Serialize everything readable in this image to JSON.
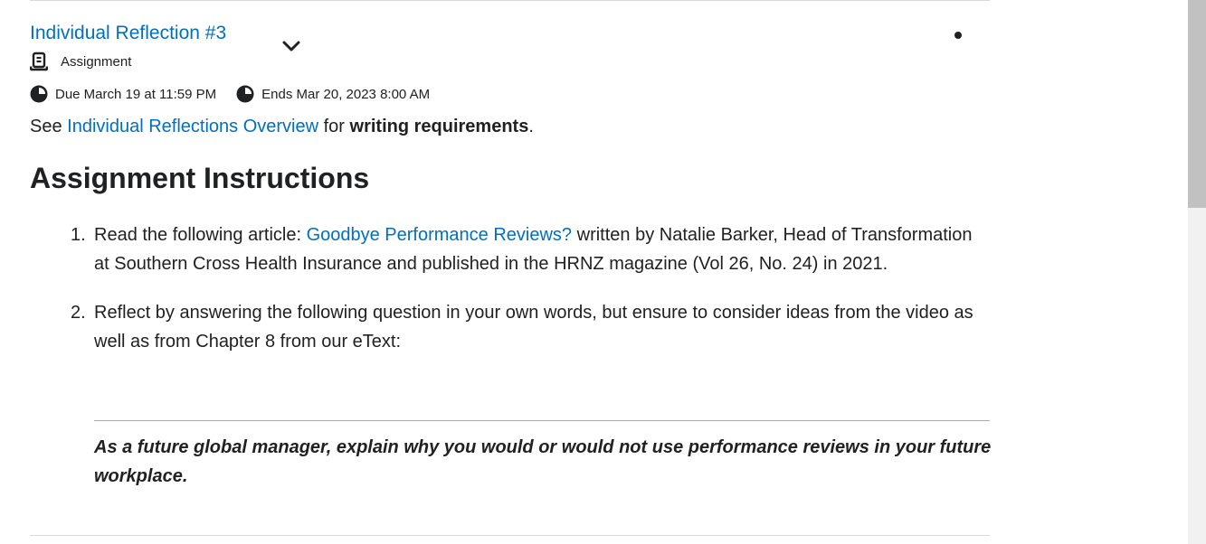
{
  "item": {
    "title": "Individual Reflection #3",
    "type_label": "Assignment",
    "due": "Due March 19 at 11:59 PM",
    "ends": "Ends Mar 20, 2023 8:00 AM"
  },
  "intro": {
    "prefix": "See ",
    "link": "Individual Reflections Overview",
    "middle": " for ",
    "bold": "writing requirements",
    "suffix": "."
  },
  "heading": "Assignment Instructions",
  "steps": [
    {
      "num": "1.",
      "before": "Read the following article: ",
      "link": "Goodbye Performance Reviews?",
      "after": " written by Natalie Barker, Head of Transformation at Southern Cross Health Insurance and published in the HRNZ magazine (Vol 26, No. 24) in 2021."
    },
    {
      "num": "2.",
      "text": "Reflect by answering the following question in your own words, but ensure to consider ideas from the video as well as from Chapter 8 from our eText:"
    }
  ],
  "question": "As a future global manager, explain why you would or would not use performance reviews in your future workplace.",
  "icons": {
    "type_icon": "assignment-icon",
    "expand_icon": "chevron-down-icon",
    "due_icon": "clock-icon",
    "ends_icon": "clock-icon",
    "status_icon": "dot-icon"
  },
  "colors": {
    "link": "#006fbf",
    "text": "#202122",
    "rule": "#d6d9dc"
  }
}
